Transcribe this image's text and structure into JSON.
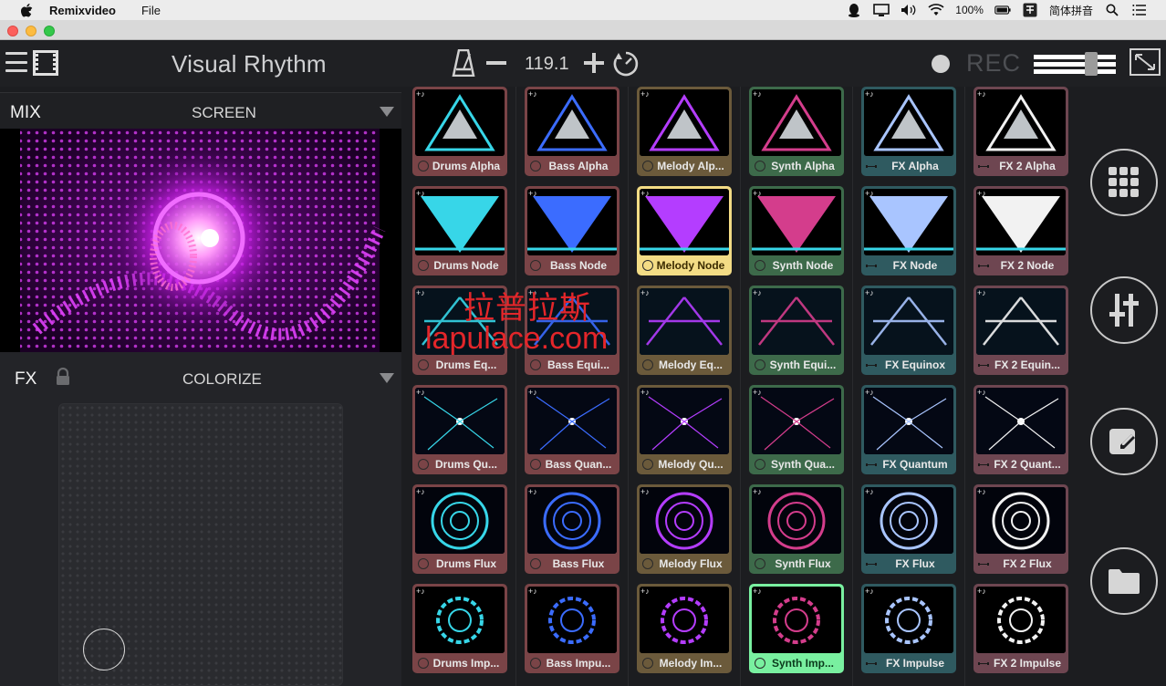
{
  "menubar": {
    "app_name": "Remixvideo",
    "menu_file": "File",
    "battery": "100%",
    "input_method": "简体拼音"
  },
  "toolbar": {
    "title": "Visual Rhythm",
    "bpm": "119.1",
    "rec_label": "REC"
  },
  "mix": {
    "label": "MIX",
    "blend_mode": "SCREEN"
  },
  "fx": {
    "label": "FX",
    "effect": "COLORIZE"
  },
  "watermark": {
    "cn": "拉普拉斯",
    "en": "lapulace.com"
  },
  "clips": {
    "drums": [
      "Drums Alpha",
      "Drums Node",
      "Drums Eq...",
      "Drums Qu...",
      "Drums Flux",
      "Drums Imp..."
    ],
    "bass": [
      "Bass Alpha",
      "Bass Node",
      "Bass Equi...",
      "Bass Quan...",
      "Bass Flux",
      "Bass Impu..."
    ],
    "melody": [
      "Melody Alp...",
      "Melody Node",
      "Melody Eq...",
      "Melody Qu...",
      "Melody Flux",
      "Melody Im..."
    ],
    "synth": [
      "Synth Alpha",
      "Synth Node",
      "Synth Equi...",
      "Synth Qua...",
      "Synth Flux",
      "Synth Imp..."
    ],
    "fx": [
      "FX Alpha",
      "FX Node",
      "FX Equinox",
      "FX Quantum",
      "FX Flux",
      "FX Impulse"
    ],
    "fx2": [
      "FX 2 Alpha",
      "FX 2 Node",
      "FX 2 Equin...",
      "FX 2 Quant...",
      "FX 2 Flux",
      "FX 2 Impulse"
    ]
  },
  "active_clips": [
    "Melody Node",
    "Synth Imp..."
  ],
  "side_buttons": [
    "grid-icon",
    "mixer-icon",
    "edit-icon",
    "folder-icon"
  ],
  "colors": {
    "accent_magenta": "#e040fb",
    "active_melody": "#f3dc85",
    "active_synth": "#79f0a0",
    "watermark": "#e3262a"
  }
}
